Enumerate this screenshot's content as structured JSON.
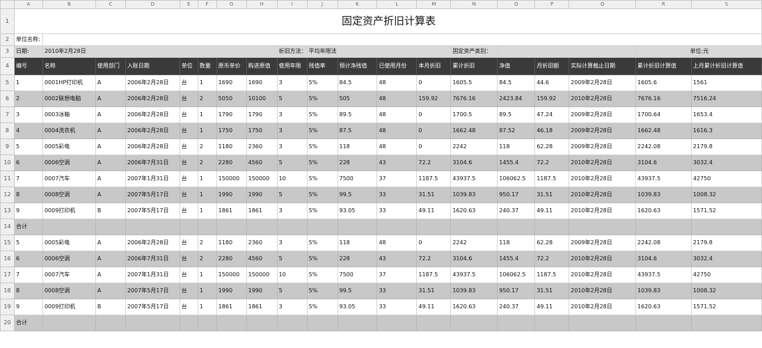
{
  "sheet": {
    "column_letters": [
      "A",
      "B",
      "C",
      "D",
      "E",
      "F",
      "G",
      "H",
      "I",
      "J",
      "K",
      "L",
      "M",
      "N",
      "O",
      "P",
      "Q",
      "R",
      "S"
    ],
    "title": "固定资产折旧计算表",
    "info": {
      "unit_name_label": "单位名称:",
      "date_label": "日期:",
      "date_value": "2010年2月28日",
      "method_label": "折旧方法：",
      "method_value": "平均年限法",
      "category_label": "固定资产类别：",
      "unit_label": "单位:元"
    },
    "headers": [
      "编号",
      "名称",
      "使用部门",
      "入账日期",
      "单位",
      "数量",
      "原币单价",
      "购进原值",
      "使用年限",
      "残值率",
      "预计净残值",
      "已使用月份",
      "本月折旧",
      "累计折旧",
      "净值",
      "月折旧额",
      "实际计算截止日期",
      "累计折旧计算值",
      "上月累计折旧计算值"
    ],
    "rows": [
      {
        "n": "5",
        "shade": false,
        "cells": [
          "1",
          "0001HP打印机",
          "A",
          "2006年2月28日",
          "台",
          "1",
          "1690",
          "1690",
          "3",
          "5%",
          "84.5",
          "48",
          "0",
          "1605.5",
          "84.5",
          "44.6",
          "2009年2月28日",
          "1605.6",
          "1561"
        ]
      },
      {
        "n": "6",
        "shade": true,
        "cells": [
          "2",
          "0002联想电脑",
          "A",
          "2006年2月28日",
          "台",
          "2",
          "5050",
          "10100",
          "5",
          "5%",
          "505",
          "48",
          "159.92",
          "7676.16",
          "2423.84",
          "159.92",
          "2010年2月28日",
          "7676.16",
          "7516.24"
        ]
      },
      {
        "n": "7",
        "shade": false,
        "cells": [
          "3",
          "0003冰箱",
          "A",
          "2006年2月28日",
          "台",
          "1",
          "1790",
          "1790",
          "3",
          "5%",
          "89.5",
          "48",
          "0",
          "1700.5",
          "89.5",
          "47.24",
          "2009年2月28日",
          "1700.64",
          "1653.4"
        ]
      },
      {
        "n": "8",
        "shade": true,
        "cells": [
          "4",
          "0004洗衣机",
          "A",
          "2006年2月28日",
          "台",
          "1",
          "1750",
          "1750",
          "3",
          "5%",
          "87.5",
          "48",
          "0",
          "1662.48",
          "87.52",
          "46.18",
          "2009年2月28日",
          "1662.48",
          "1616.3"
        ]
      },
      {
        "n": "9",
        "shade": false,
        "cells": [
          "5",
          "0005彩电",
          "A",
          "2006年2月28日",
          "台",
          "2",
          "1180",
          "2360",
          "3",
          "5%",
          "118",
          "48",
          "0",
          "2242",
          "118",
          "62.28",
          "2009年2月28日",
          "2242.08",
          "2179.8"
        ]
      },
      {
        "n": "10",
        "shade": true,
        "cells": [
          "6",
          "0006空调",
          "A",
          "2006年7月31日",
          "台",
          "2",
          "2280",
          "4560",
          "5",
          "5%",
          "228",
          "43",
          "72.2",
          "3104.6",
          "1455.4",
          "72.2",
          "2010年2月28日",
          "3104.6",
          "3032.4"
        ]
      },
      {
        "n": "11",
        "shade": false,
        "cells": [
          "7",
          "0007汽车",
          "A",
          "2007年1月31日",
          "台",
          "1",
          "150000",
          "150000",
          "10",
          "5%",
          "7500",
          "37",
          "1187.5",
          "43937.5",
          "106062.5",
          "1187.5",
          "2010年2月28日",
          "43937.5",
          "42750"
        ]
      },
      {
        "n": "12",
        "shade": true,
        "cells": [
          "8",
          "0008空调",
          "A",
          "2007年5月17日",
          "台",
          "1",
          "1990",
          "1990",
          "5",
          "5%",
          "99.5",
          "33",
          "31.51",
          "1039.83",
          "950.17",
          "31.51",
          "2010年2月28日",
          "1039.83",
          "1008.32"
        ]
      },
      {
        "n": "13",
        "shade": false,
        "cells": [
          "9",
          "0009打印机",
          "B",
          "2007年5月17日",
          "台",
          "1",
          "1861",
          "1861",
          "3",
          "5%",
          "93.05",
          "33",
          "49.11",
          "1620.63",
          "240.37",
          "49.11",
          "2010年2月28日",
          "1620.63",
          "1571.52"
        ]
      },
      {
        "n": "14",
        "total": true,
        "cells": [
          "合计",
          "",
          "",
          "",
          "",
          "",
          "",
          "",
          "",
          "",
          "",
          "",
          "",
          "",
          "",
          "",
          "",
          "",
          ""
        ]
      },
      {
        "n": "15",
        "shade": false,
        "cells": [
          "5",
          "0005彩电",
          "A",
          "2006年2月28日",
          "台",
          "2",
          "1180",
          "2360",
          "3",
          "5%",
          "118",
          "48",
          "0",
          "2242",
          "118",
          "62.28",
          "2009年2月28日",
          "2242.08",
          "2179.8"
        ]
      },
      {
        "n": "16",
        "shade": true,
        "cells": [
          "6",
          "0006空调",
          "A",
          "2006年7月31日",
          "台",
          "2",
          "2280",
          "4560",
          "5",
          "5%",
          "228",
          "43",
          "72.2",
          "3104.6",
          "1455.4",
          "72.2",
          "2010年2月28日",
          "3104.6",
          "3032.4"
        ]
      },
      {
        "n": "17",
        "shade": false,
        "cells": [
          "7",
          "0007汽车",
          "A",
          "2007年1月31日",
          "台",
          "1",
          "150000",
          "150000",
          "10",
          "5%",
          "7500",
          "37",
          "1187.5",
          "43937.5",
          "106062.5",
          "1187.5",
          "2010年2月28日",
          "43937.5",
          "42750"
        ]
      },
      {
        "n": "18",
        "shade": true,
        "cells": [
          "8",
          "0008空调",
          "A",
          "2007年5月17日",
          "台",
          "1",
          "1990",
          "1990",
          "5",
          "5%",
          "99.5",
          "33",
          "31.51",
          "1039.83",
          "950.17",
          "31.51",
          "2010年2月28日",
          "1039.83",
          "1008.32"
        ]
      },
      {
        "n": "19",
        "shade": false,
        "cells": [
          "9",
          "0009打印机",
          "B",
          "2007年5月17日",
          "台",
          "1",
          "1861",
          "1861",
          "3",
          "5%",
          "93.05",
          "33",
          "49.11",
          "1620.63",
          "240.37",
          "49.11",
          "2010年2月28日",
          "1620.63",
          "1571.52"
        ]
      },
      {
        "n": "20",
        "total": true,
        "cells": [
          "合计",
          "",
          "",
          "",
          "",
          "",
          "",
          "",
          "",
          "",
          "",
          "",
          "",
          "",
          "",
          "",
          "",
          "",
          ""
        ]
      }
    ],
    "row_numbers": {
      "title": "1",
      "unit": "2",
      "date": "3",
      "header": "4"
    }
  }
}
